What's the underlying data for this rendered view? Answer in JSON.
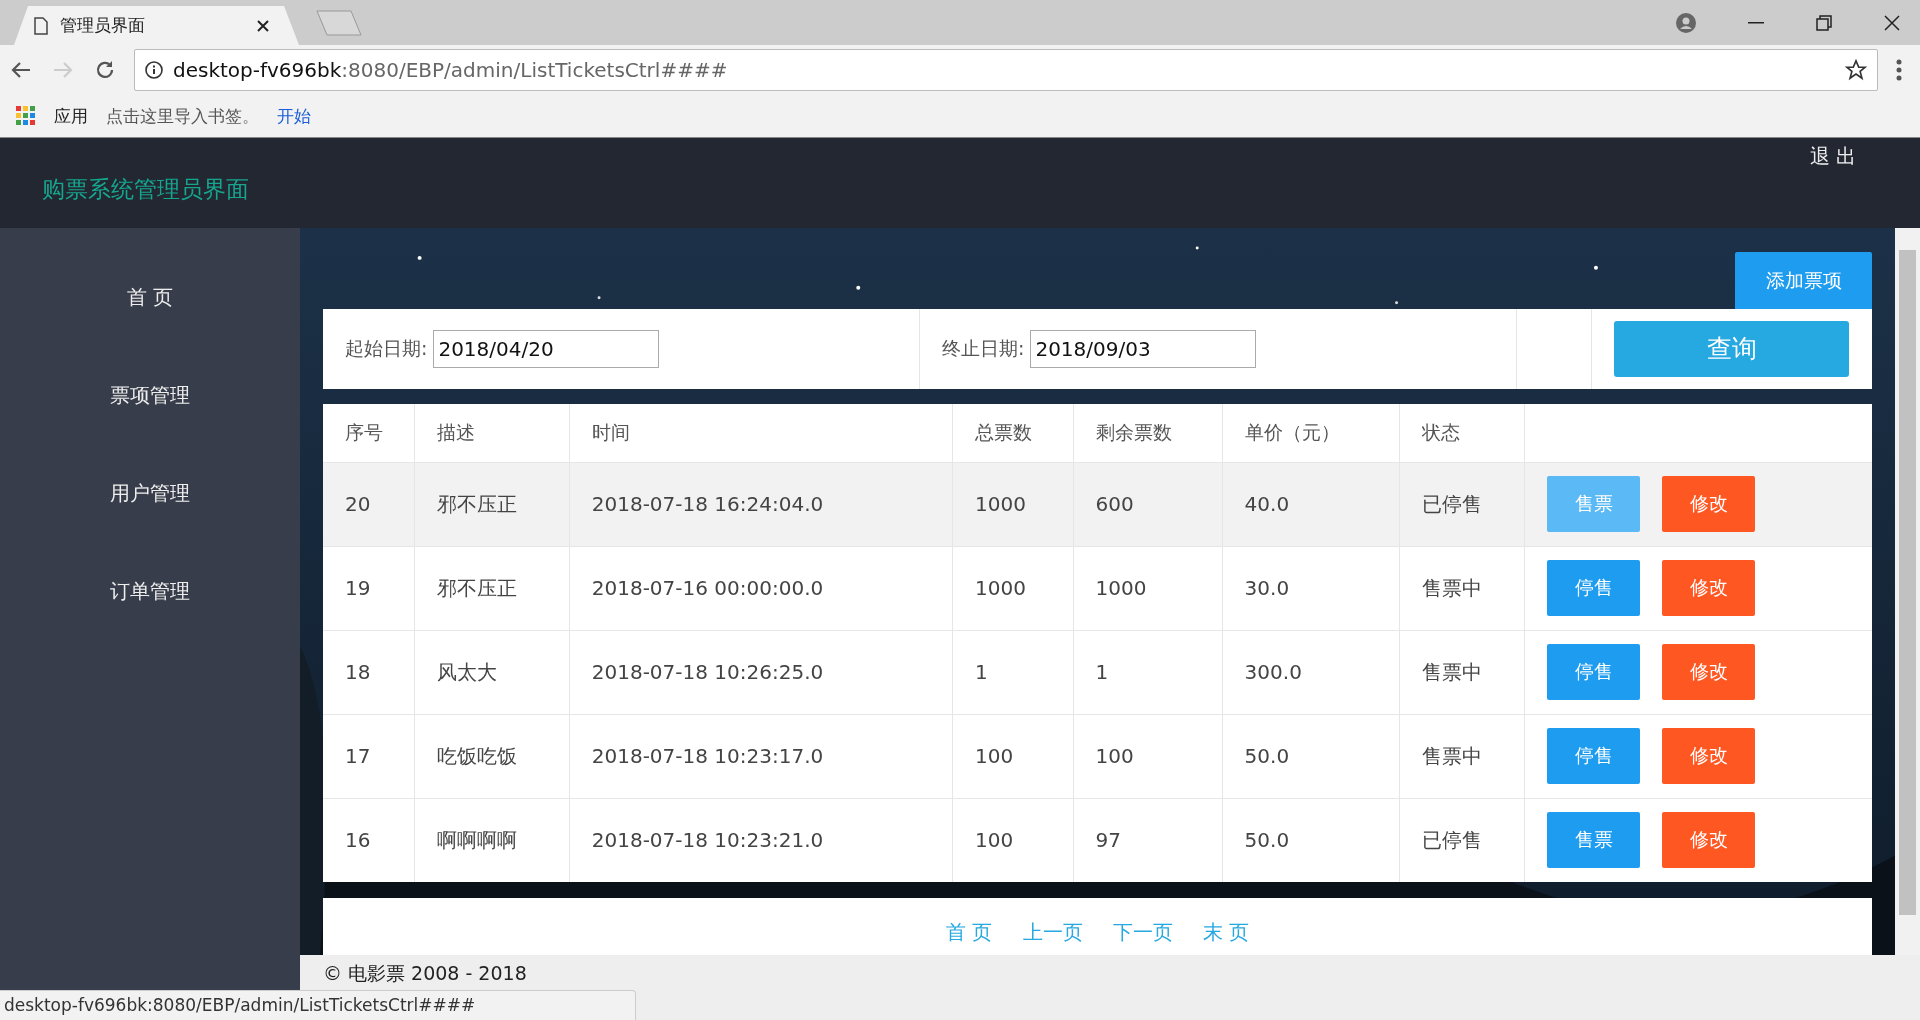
{
  "browser": {
    "tab_title": "管理员界面",
    "url_host": "desktop-fv696bk",
    "url_path": ":8080/EBP/admin/ListTicketsCtrl####",
    "bookmarks": [
      {
        "label": "应用",
        "kind": "apps"
      },
      {
        "label": "点击这里导入书签。",
        "kind": "hint"
      },
      {
        "label": "开始",
        "kind": "link"
      }
    ]
  },
  "header": {
    "title": "购票系统管理员界面",
    "logout": "退 出"
  },
  "sidebar": {
    "items": [
      {
        "label": "首 页"
      },
      {
        "label": "票项管理"
      },
      {
        "label": "用户管理"
      },
      {
        "label": "订单管理"
      }
    ]
  },
  "add_button": "添加票项",
  "search": {
    "fields": [
      {
        "label": "起始日期:",
        "value": "2018/04/20"
      },
      {
        "label": "终止日期:",
        "value": "2018/09/03"
      }
    ],
    "button": "查询"
  },
  "table": {
    "columns": [
      "序号",
      "描述",
      "时间",
      "总票数",
      "剩余票数",
      "单价（元）",
      "状态"
    ],
    "rows": [
      {
        "cells": [
          "20",
          "邪不压正",
          "2018-07-18 16:24:04.0",
          "1000",
          "600",
          "40.0",
          "已停售"
        ],
        "actions": [
          "售票",
          "修改"
        ],
        "highlighted": true
      },
      {
        "cells": [
          "19",
          "邪不压正",
          "2018-07-16 00:00:00.0",
          "1000",
          "1000",
          "30.0",
          "售票中"
        ],
        "actions": [
          "停售",
          "修改"
        ],
        "highlighted": false
      },
      {
        "cells": [
          "18",
          "风太大",
          "2018-07-18 10:26:25.0",
          "1",
          "1",
          "300.0",
          "售票中"
        ],
        "actions": [
          "停售",
          "修改"
        ],
        "highlighted": false
      },
      {
        "cells": [
          "17",
          "吃饭吃饭",
          "2018-07-18 10:23:17.0",
          "100",
          "100",
          "50.0",
          "售票中"
        ],
        "actions": [
          "停售",
          "修改"
        ],
        "highlighted": false
      },
      {
        "cells": [
          "16",
          "啊啊啊啊",
          "2018-07-18 10:23:21.0",
          "100",
          "97",
          "50.0",
          "已停售"
        ],
        "actions": [
          "售票",
          "修改"
        ],
        "highlighted": false
      }
    ]
  },
  "pagination": [
    "首 页",
    "上一页",
    "下一页",
    "末 页"
  ],
  "footer": "© 电影票 2008 - 2018",
  "status_bar": "desktop-fv696bk:8080/EBP/admin/ListTicketsCtrl####"
}
